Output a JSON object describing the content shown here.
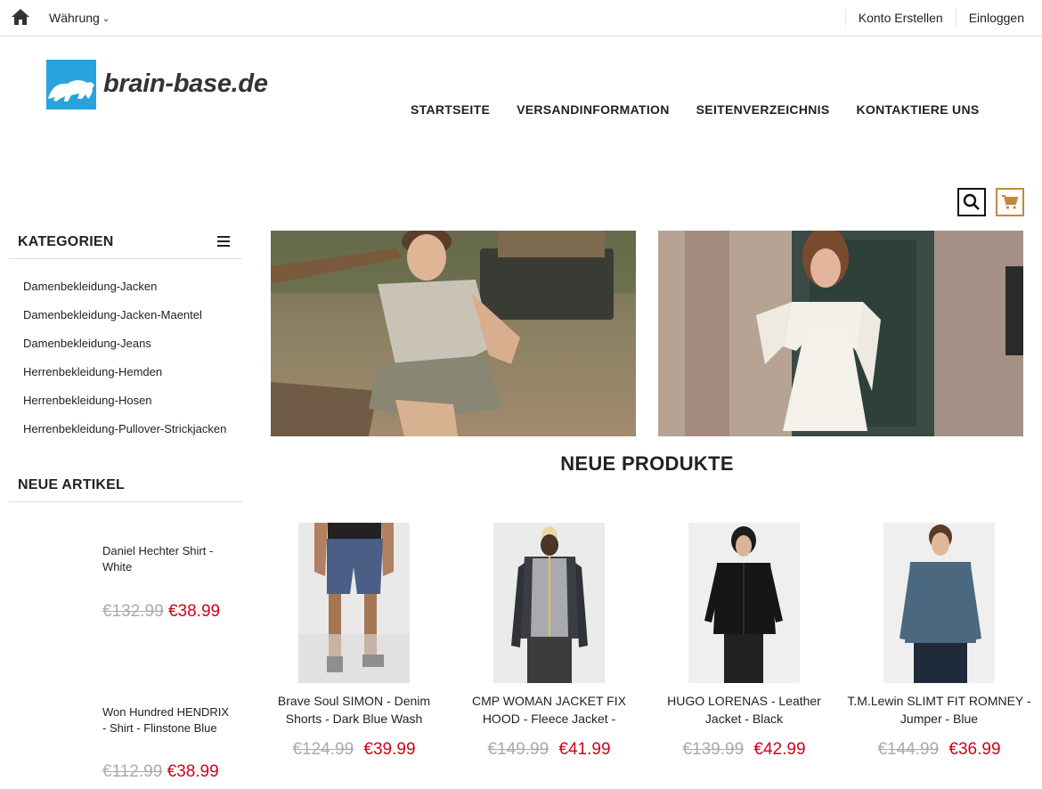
{
  "topbar": {
    "currency_label": "Währung",
    "links": [
      "Konto Erstellen",
      "Einloggen"
    ]
  },
  "logo": {
    "text": "brain-base.de",
    "color": "#29a3dc"
  },
  "nav": [
    "STARTSEITE",
    "VERSANDINFORMATION",
    "SEITENVERZEICHNIS",
    "KONTAKTIERE UNS"
  ],
  "icons": {
    "home": "home-icon",
    "search": "search-icon",
    "cart": "cart-icon",
    "menu": "hamburger-icon"
  },
  "colors": {
    "price_new": "#d0021b",
    "price_old": "#aaaaaa",
    "cart_border": "#c08a3e"
  },
  "sidebar": {
    "categories_title": "KATEGORIEN",
    "categories": [
      "Damenbekleidung-Jacken",
      "Damenbekleidung-Jacken-Maentel",
      "Damenbekleidung-Jeans",
      "Herrenbekleidung-Hemden",
      "Herrenbekleidung-Hosen",
      "Herrenbekleidung-Pullover-Strickjacken"
    ],
    "new_title": "NEUE ARTIKEL",
    "new_items": [
      {
        "name": "Daniel Hechter Shirt - White",
        "old_price": "€132.99",
        "price": "€38.99"
      },
      {
        "name": "Won Hundred HENDRIX - Shirt - Flinstone Blue",
        "old_price": "€112.99",
        "price": "€38.99"
      }
    ]
  },
  "main": {
    "section_title": "NEUE PRODUKTE",
    "products": [
      {
        "name": "Brave Soul SIMON - Denim Shorts - Dark Blue Wash",
        "old_price": "€124.99",
        "price": "€39.99"
      },
      {
        "name": "CMP WOMAN JACKET FIX HOOD - Fleece Jacket -",
        "old_price": "€149.99",
        "price": "€41.99"
      },
      {
        "name": "HUGO LORENAS - Leather Jacket - Black",
        "old_price": "€139.99",
        "price": "€42.99"
      },
      {
        "name": "T.M.Lewin SLIMT FIT ROMNEY - Jumper - Blue",
        "old_price": "€144.99",
        "price": "€36.99"
      }
    ]
  }
}
